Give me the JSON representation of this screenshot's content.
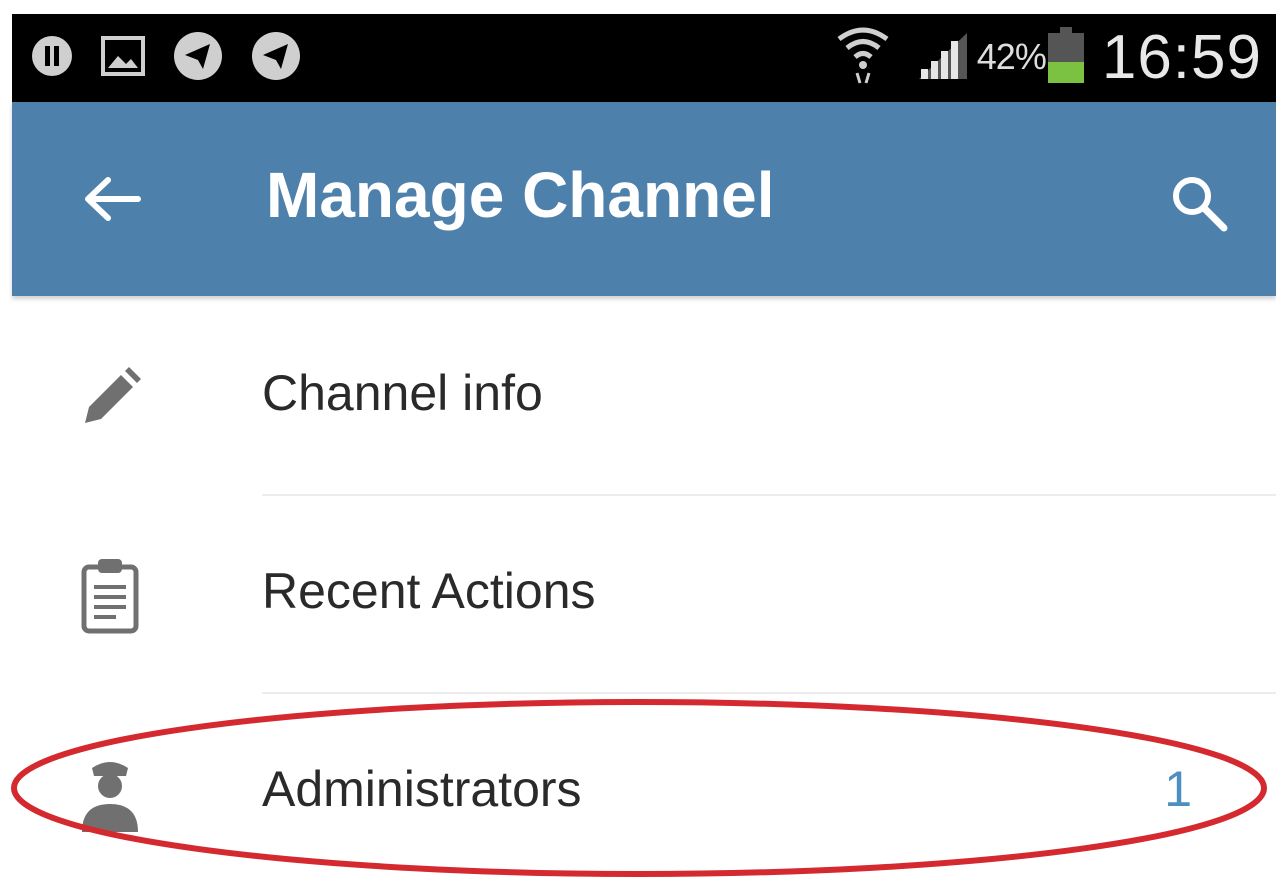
{
  "status_bar": {
    "battery_percent": "42%",
    "time": "16:59",
    "icons": [
      "pause-circle-icon",
      "image-icon",
      "telegram-icon",
      "telegram-icon",
      "wifi-icon",
      "signal-icon",
      "battery-icon"
    ],
    "battery_level": 0.42
  },
  "app_bar": {
    "title": "Manage Channel",
    "background_color": "#4d80ab",
    "icons": [
      "back-arrow-icon",
      "search-icon"
    ]
  },
  "menu": {
    "items": [
      {
        "label": "Channel info",
        "icon": "pencil-icon",
        "value": ""
      },
      {
        "label": "Recent Actions",
        "icon": "clipboard-icon",
        "value": ""
      },
      {
        "label": "Administrators",
        "icon": "admin-badge-icon",
        "value": "1"
      }
    ]
  },
  "annotation": {
    "highlight_color": "#d42a2f",
    "highlighted_item": "Administrators"
  }
}
